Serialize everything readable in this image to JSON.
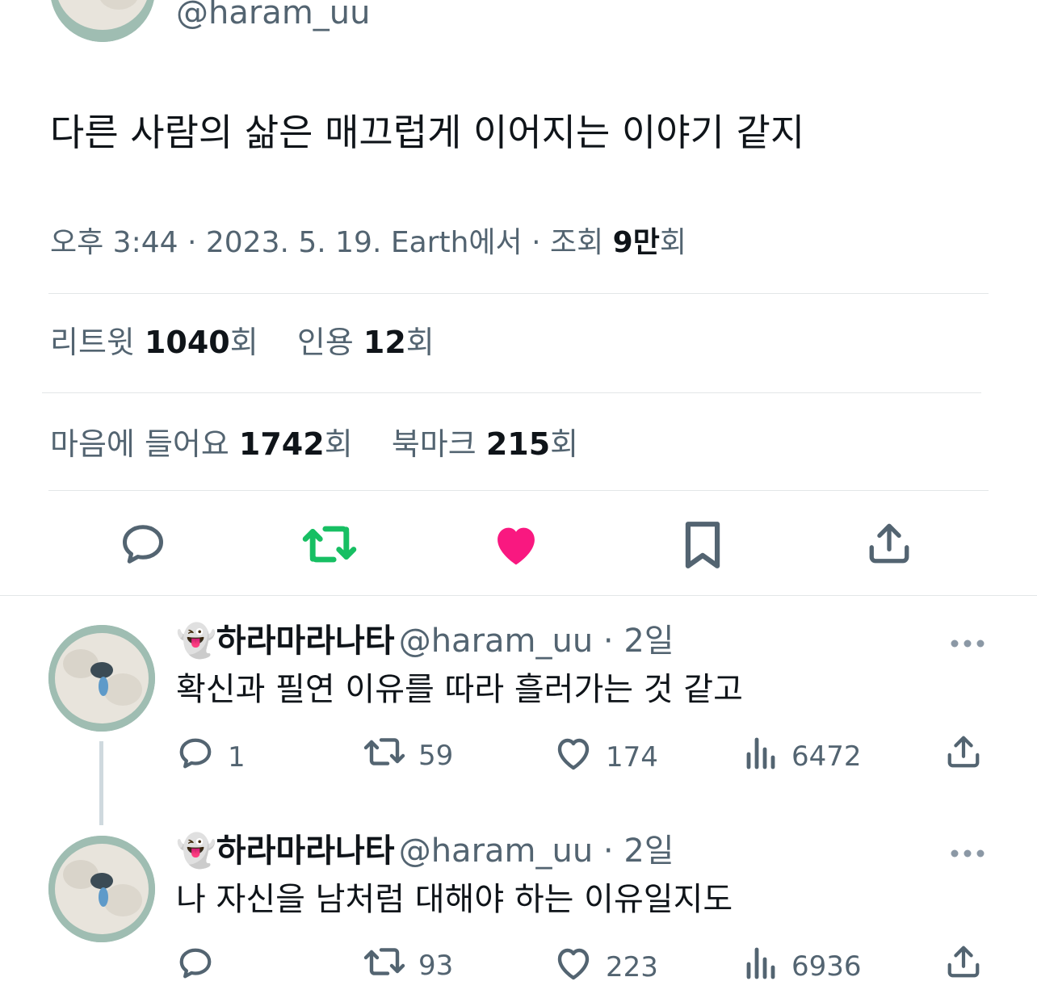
{
  "main_tweet": {
    "handle": "@haram_uu",
    "text": "다른 사람의 삶은 매끄럽게 이어지는 이야기 같지",
    "meta_prefix": "오후 3:44 · 2023. 5. 19. Earth에서 · 조회 ",
    "views_value": "9만",
    "views_suffix": "회"
  },
  "stats": {
    "retweet_label": "리트윗 ",
    "retweet_count": "1040",
    "retweet_suffix": "회",
    "quote_label": "인용 ",
    "quote_count": "12",
    "quote_suffix": "회",
    "like_label": "마음에 들어요 ",
    "like_count": "1742",
    "like_suffix": "회",
    "bookmark_label": "북마크 ",
    "bookmark_count": "215",
    "bookmark_suffix": "회"
  },
  "action_icons": [
    "reply-icon",
    "retweet-icon",
    "like-icon",
    "bookmark-icon",
    "share-icon"
  ],
  "colors": {
    "retweet_active": "#17bf63",
    "like_active": "#f91880",
    "text_secondary": "#536471"
  },
  "replies": [
    {
      "name": "👻하라마라나타",
      "handle_time": "@haram_uu · 2일",
      "text": "확신과 필연 이유를 따라 흘러가는 것 같고",
      "reply_count": "1",
      "retweet_count": "59",
      "like_count": "174",
      "view_count": "6472"
    },
    {
      "name": "👻하라마라나타",
      "handle_time": "@haram_uu · 2일",
      "text": "나 자신을 남처럼 대해야 하는 이유일지도",
      "reply_count": "",
      "retweet_count": "93",
      "like_count": "223",
      "view_count": "6936"
    }
  ]
}
